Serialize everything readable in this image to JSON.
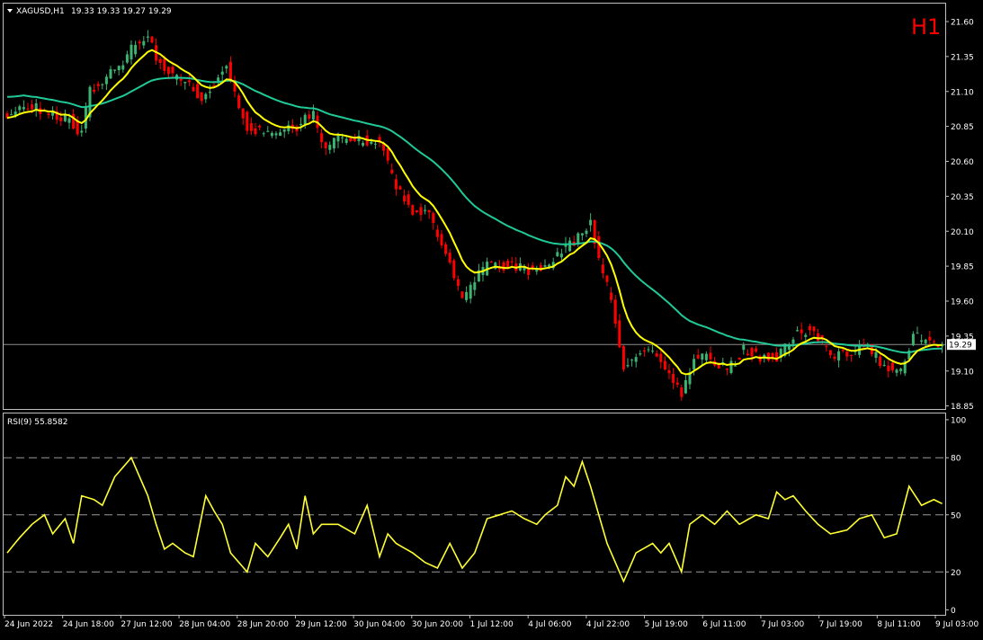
{
  "header": {
    "symbol": "XAGUSD,H1",
    "ohlc": "19.33 19.33 19.27 19.29",
    "timeframe_badge": "H1"
  },
  "rsi_header": {
    "label": "RSI(9) 55.8582"
  },
  "current_price_label": "19.29",
  "colors": {
    "background": "#000000",
    "frame": "#c0c0c0",
    "bull": "#3cb371",
    "bear": "#ff0000",
    "ma_fast": "#ffff00",
    "ma_slow": "#20c997",
    "rsi_line": "#ffff33",
    "price_line": "#8c8c8c",
    "badge": "#ff0000",
    "axis_text": "#ffffff"
  },
  "icons": {
    "header_menu": "triangle-down-icon"
  },
  "chart_data": [
    {
      "type": "candlestick",
      "title": "XAGUSD,H1",
      "y_ticks": [
        "21.60",
        "21.35",
        "21.10",
        "20.85",
        "20.60",
        "20.35",
        "20.10",
        "19.85",
        "19.60",
        "19.35",
        "19.10",
        "18.85"
      ],
      "ylim": [
        18.8,
        21.7
      ],
      "x_ticks": [
        "24 Jun 2022",
        "24 Jun 18:00",
        "27 Jun 12:00",
        "28 Jun 04:00",
        "28 Jun 20:00",
        "29 Jun 12:00",
        "30 Jun 04:00",
        "30 Jun 20:00",
        "1 Jul 12:00",
        "4 Jul 06:00",
        "4 Jul 22:00",
        "5 Jul 19:00",
        "6 Jul 11:00",
        "7 Jul 03:00",
        "7 Jul 19:00",
        "8 Jul 11:00",
        "9 Jul 03:00"
      ],
      "grid": false,
      "last_price": 19.29,
      "price_anchors": [
        [
          0,
          20.95
        ],
        [
          5,
          21.0
        ],
        [
          10,
          20.95
        ],
        [
          15,
          20.9
        ],
        [
          18,
          20.8
        ],
        [
          20,
          21.1
        ],
        [
          24,
          21.2
        ],
        [
          28,
          21.3
        ],
        [
          31,
          21.45
        ],
        [
          34,
          21.5
        ],
        [
          36,
          21.35
        ],
        [
          40,
          21.2
        ],
        [
          44,
          21.15
        ],
        [
          47,
          21.05
        ],
        [
          51,
          21.2
        ],
        [
          53,
          21.3
        ],
        [
          55,
          21.1
        ],
        [
          58,
          20.85
        ],
        [
          62,
          20.8
        ],
        [
          66,
          20.8
        ],
        [
          70,
          20.85
        ],
        [
          74,
          20.95
        ],
        [
          76,
          20.7
        ],
        [
          80,
          20.75
        ],
        [
          86,
          20.75
        ],
        [
          90,
          20.75
        ],
        [
          94,
          20.4
        ],
        [
          98,
          20.25
        ],
        [
          102,
          20.2
        ],
        [
          106,
          19.95
        ],
        [
          110,
          19.6
        ],
        [
          113,
          19.75
        ],
        [
          116,
          19.85
        ],
        [
          120,
          19.85
        ],
        [
          126,
          19.82
        ],
        [
          130,
          19.85
        ],
        [
          134,
          19.95
        ],
        [
          138,
          20.05
        ],
        [
          141,
          20.15
        ],
        [
          143,
          19.9
        ],
        [
          146,
          19.6
        ],
        [
          149,
          19.15
        ],
        [
          152,
          19.2
        ],
        [
          156,
          19.25
        ],
        [
          160,
          19.1
        ],
        [
          163,
          18.95
        ],
        [
          166,
          19.2
        ],
        [
          170,
          19.2
        ],
        [
          174,
          19.1
        ],
        [
          178,
          19.25
        ],
        [
          182,
          19.2
        ],
        [
          186,
          19.2
        ],
        [
          190,
          19.35
        ],
        [
          194,
          19.4
        ],
        [
          197,
          19.3
        ],
        [
          200,
          19.2
        ],
        [
          204,
          19.25
        ],
        [
          208,
          19.25
        ],
        [
          212,
          19.15
        ],
        [
          216,
          19.1
        ],
        [
          219,
          19.35
        ],
        [
          223,
          19.3
        ],
        [
          226,
          19.29
        ]
      ],
      "moving_averages": [
        {
          "type": "ema",
          "period": 9,
          "color": "#ffff00"
        },
        {
          "type": "ema",
          "period": 40,
          "color": "#20c997"
        }
      ]
    },
    {
      "type": "line",
      "title": "RSI(9) 55.8582",
      "y_ticks": [
        "100",
        "80",
        "50",
        "20",
        "0"
      ],
      "ylim": [
        0,
        100
      ],
      "reference_levels": [
        80,
        50,
        20
      ],
      "rsi_anchors": [
        [
          0,
          30
        ],
        [
          3,
          38
        ],
        [
          6,
          45
        ],
        [
          9,
          50
        ],
        [
          11,
          40
        ],
        [
          14,
          48
        ],
        [
          16,
          35
        ],
        [
          18,
          60
        ],
        [
          21,
          58
        ],
        [
          23,
          55
        ],
        [
          26,
          70
        ],
        [
          28,
          75
        ],
        [
          30,
          80
        ],
        [
          32,
          70
        ],
        [
          34,
          60
        ],
        [
          36,
          45
        ],
        [
          38,
          32
        ],
        [
          40,
          35
        ],
        [
          43,
          30
        ],
        [
          45,
          28
        ],
        [
          48,
          60
        ],
        [
          50,
          52
        ],
        [
          52,
          45
        ],
        [
          54,
          30
        ],
        [
          56,
          25
        ],
        [
          58,
          20
        ],
        [
          60,
          35
        ],
        [
          63,
          28
        ],
        [
          66,
          38
        ],
        [
          68,
          45
        ],
        [
          70,
          32
        ],
        [
          72,
          60
        ],
        [
          74,
          40
        ],
        [
          76,
          45
        ],
        [
          80,
          45
        ],
        [
          84,
          40
        ],
        [
          87,
          55
        ],
        [
          90,
          28
        ],
        [
          92,
          40
        ],
        [
          94,
          35
        ],
        [
          98,
          30
        ],
        [
          101,
          25
        ],
        [
          104,
          22
        ],
        [
          107,
          35
        ],
        [
          110,
          22
        ],
        [
          113,
          30
        ],
        [
          116,
          48
        ],
        [
          119,
          50
        ],
        [
          122,
          52
        ],
        [
          125,
          48
        ],
        [
          128,
          45
        ],
        [
          130,
          50
        ],
        [
          133,
          55
        ],
        [
          135,
          70
        ],
        [
          137,
          65
        ],
        [
          139,
          78
        ],
        [
          141,
          65
        ],
        [
          143,
          50
        ],
        [
          145,
          35
        ],
        [
          147,
          25
        ],
        [
          149,
          15
        ],
        [
          152,
          30
        ],
        [
          156,
          35
        ],
        [
          158,
          30
        ],
        [
          160,
          35
        ],
        [
          163,
          20
        ],
        [
          165,
          45
        ],
        [
          168,
          50
        ],
        [
          171,
          45
        ],
        [
          174,
          52
        ],
        [
          177,
          45
        ],
        [
          181,
          50
        ],
        [
          184,
          48
        ],
        [
          186,
          62
        ],
        [
          188,
          58
        ],
        [
          190,
          60
        ],
        [
          193,
          52
        ],
        [
          196,
          45
        ],
        [
          199,
          40
        ],
        [
          203,
          42
        ],
        [
          206,
          48
        ],
        [
          209,
          50
        ],
        [
          212,
          38
        ],
        [
          215,
          40
        ],
        [
          218,
          65
        ],
        [
          221,
          55
        ],
        [
          224,
          58
        ],
        [
          226,
          55.86
        ]
      ]
    }
  ]
}
